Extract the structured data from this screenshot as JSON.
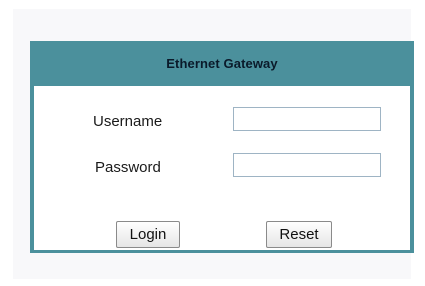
{
  "panel": {
    "title": "Ethernet Gateway"
  },
  "form": {
    "username_label": "Username",
    "username_value": "",
    "password_label": "Password",
    "password_value": ""
  },
  "actions": {
    "login_label": "Login",
    "reset_label": "Reset"
  },
  "colors": {
    "panel_accent": "#4b909c",
    "page_background": "#f8f8fa",
    "input_border": "#9eb4c4"
  }
}
